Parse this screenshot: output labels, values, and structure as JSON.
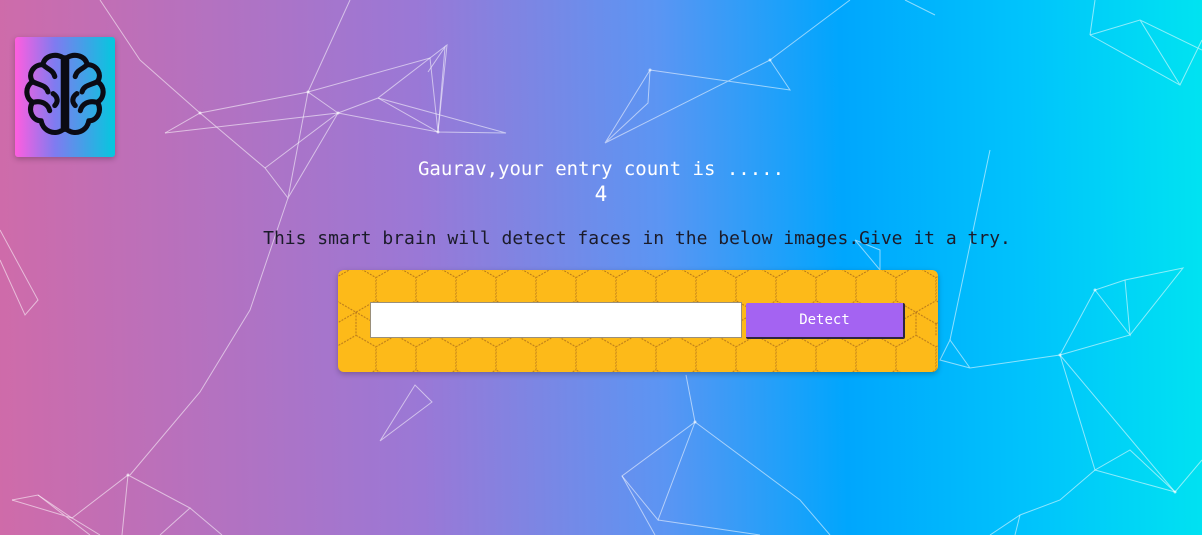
{
  "logo": {
    "icon": "brain-icon",
    "colors": {
      "left": "#ff5edf",
      "right": "#04c8de"
    }
  },
  "rank": {
    "entry_text": "Gaurav,your entry count is .....",
    "count": "4"
  },
  "image_link_form": {
    "tagline": "This smart brain will detect faces in the below images.Give it a try.",
    "input_value": "",
    "input_placeholder": "",
    "detect_label": "Detect"
  },
  "colors": {
    "card_background": "#fdba19",
    "button_background": "#a463f2",
    "entry_text": "#ffffff",
    "tagline_text": "#1b1b2a"
  }
}
